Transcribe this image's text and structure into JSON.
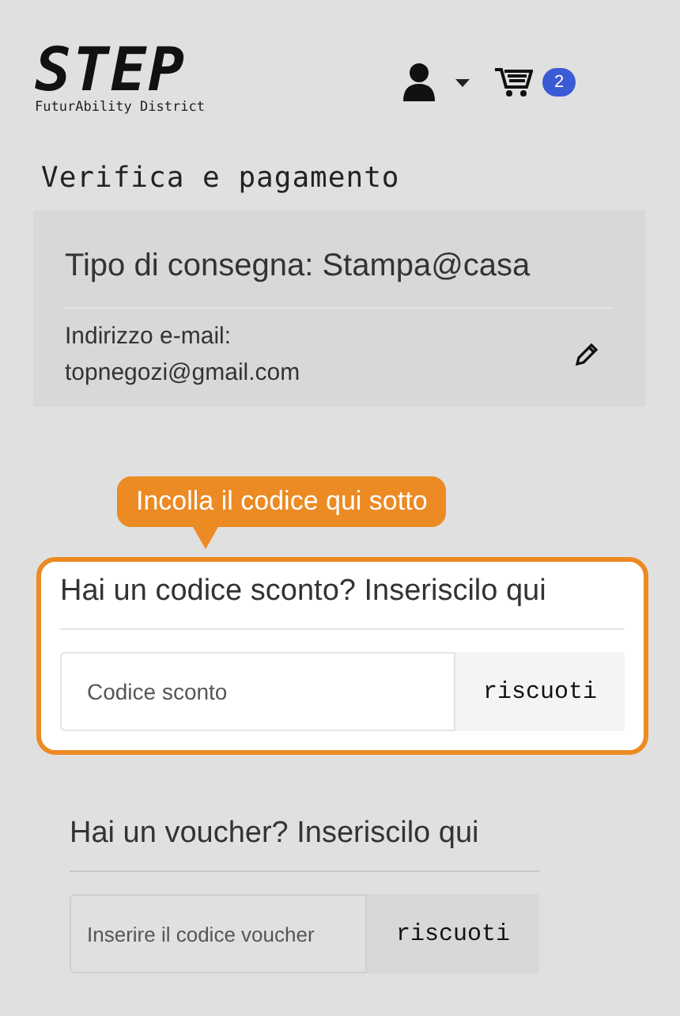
{
  "header": {
    "logo_title": "STEP",
    "logo_subtitle": "FuturAbility District",
    "cart_count": "2"
  },
  "page_title": "Verifica e pagamento",
  "delivery": {
    "title": "Tipo di consegna: Stampa@casa",
    "email_label": "Indirizzo e-mail:",
    "email": "topnegozi@gmail.com"
  },
  "tooltip": "Incolla il codice qui sotto",
  "code_sections": [
    {
      "heading": "Hai un codice sconto? Inseriscilo qui",
      "placeholder": "Codice sconto",
      "button": "riscuoti",
      "highlighted": true
    },
    {
      "heading": "Hai un voucher? Inseriscilo qui",
      "placeholder": "Inserire il codice voucher",
      "button": "riscuoti",
      "highlighted": false
    }
  ]
}
